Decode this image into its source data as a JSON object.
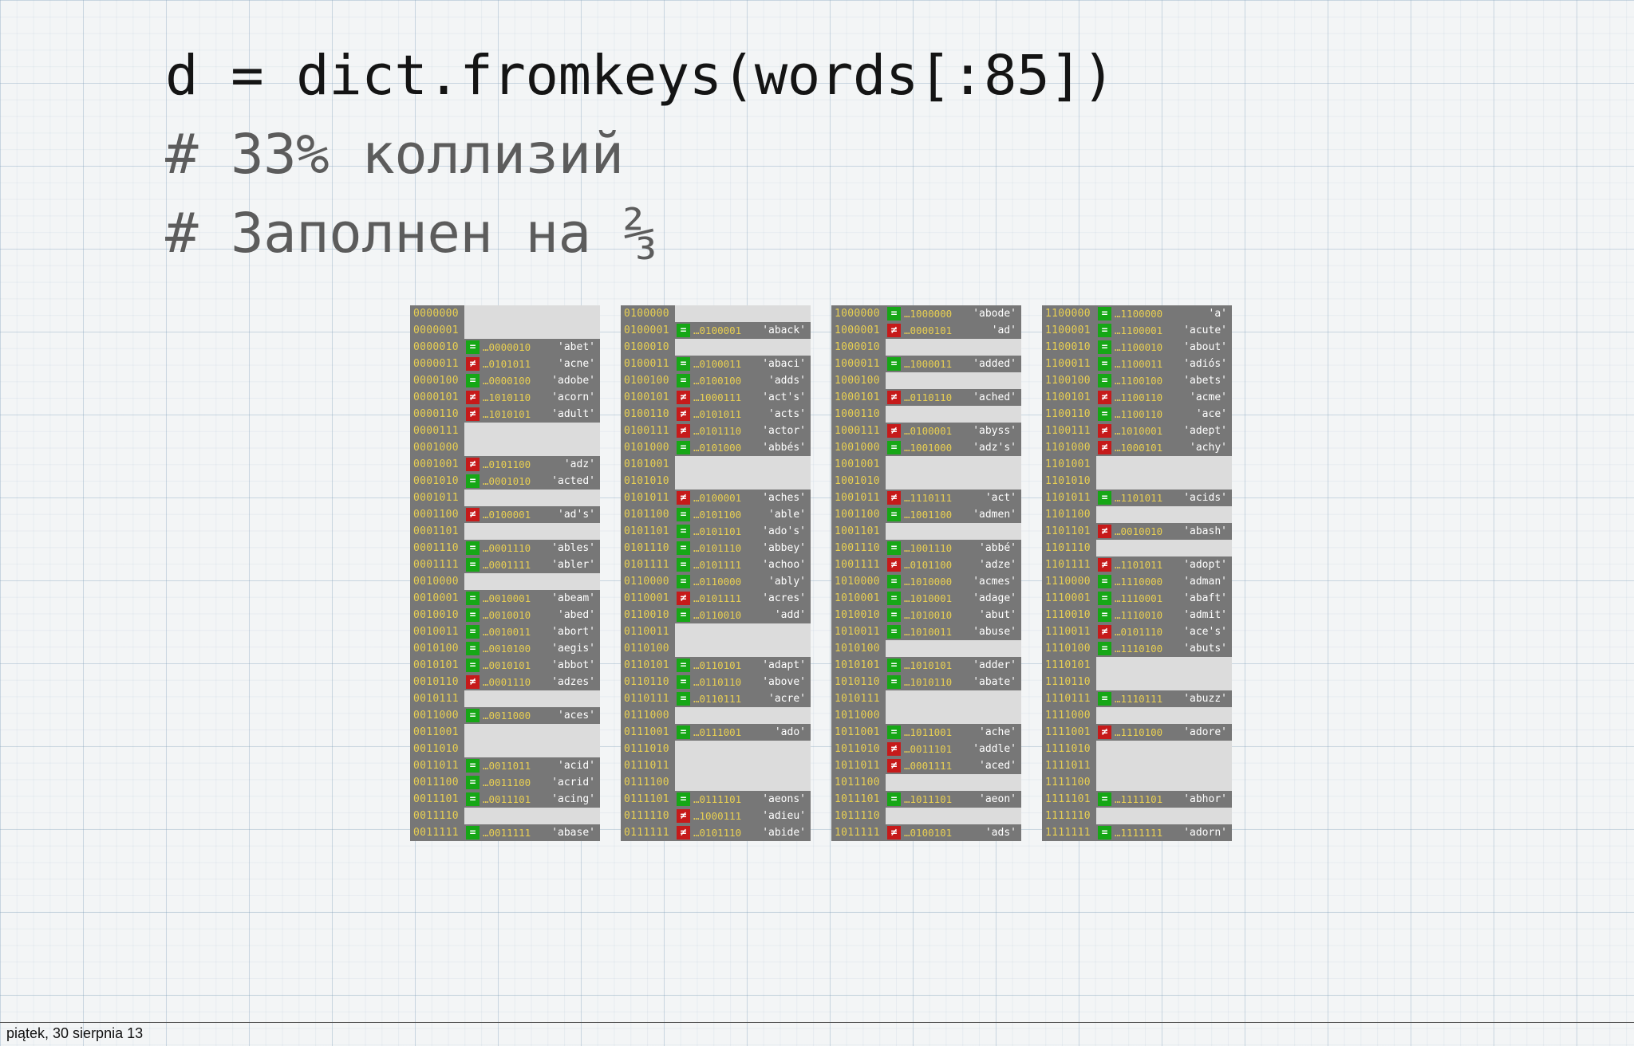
{
  "slide": {
    "code": "d = dict.fromkeys(words[:85])",
    "comment1": "# 33% коллизий",
    "comment2": "# Заполнен на ⅔"
  },
  "table": {
    "columns": [
      {
        "rows": [
          {
            "i": "0000000",
            "m": "",
            "h": "",
            "w": ""
          },
          {
            "i": "0000001",
            "m": "",
            "h": "",
            "w": ""
          },
          {
            "i": "0000010",
            "m": "=",
            "h": "…0000010",
            "w": "'abet'"
          },
          {
            "i": "0000011",
            "m": "≠",
            "h": "…0101011",
            "w": "'acne'"
          },
          {
            "i": "0000100",
            "m": "=",
            "h": "…0000100",
            "w": "'adobe'"
          },
          {
            "i": "0000101",
            "m": "≠",
            "h": "…1010110",
            "w": "'acorn'"
          },
          {
            "i": "0000110",
            "m": "≠",
            "h": "…1010101",
            "w": "'adult'"
          },
          {
            "i": "0000111",
            "m": "",
            "h": "",
            "w": ""
          },
          {
            "i": "0001000",
            "m": "",
            "h": "",
            "w": ""
          },
          {
            "i": "0001001",
            "m": "≠",
            "h": "…0101100",
            "w": "'adz'"
          },
          {
            "i": "0001010",
            "m": "=",
            "h": "…0001010",
            "w": "'acted'"
          },
          {
            "i": "0001011",
            "m": "",
            "h": "",
            "w": ""
          },
          {
            "i": "0001100",
            "m": "≠",
            "h": "…0100001",
            "w": "'ad's'"
          },
          {
            "i": "0001101",
            "m": "",
            "h": "",
            "w": ""
          },
          {
            "i": "0001110",
            "m": "=",
            "h": "…0001110",
            "w": "'ables'"
          },
          {
            "i": "0001111",
            "m": "=",
            "h": "…0001111",
            "w": "'abler'"
          },
          {
            "i": "0010000",
            "m": "",
            "h": "",
            "w": ""
          },
          {
            "i": "0010001",
            "m": "=",
            "h": "…0010001",
            "w": "'abeam'"
          },
          {
            "i": "0010010",
            "m": "=",
            "h": "…0010010",
            "w": "'abed'"
          },
          {
            "i": "0010011",
            "m": "=",
            "h": "…0010011",
            "w": "'abort'"
          },
          {
            "i": "0010100",
            "m": "=",
            "h": "…0010100",
            "w": "'aegis'"
          },
          {
            "i": "0010101",
            "m": "=",
            "h": "…0010101",
            "w": "'abbot'"
          },
          {
            "i": "0010110",
            "m": "≠",
            "h": "…0001110",
            "w": "'adzes'"
          },
          {
            "i": "0010111",
            "m": "",
            "h": "",
            "w": ""
          },
          {
            "i": "0011000",
            "m": "=",
            "h": "…0011000",
            "w": "'aces'"
          },
          {
            "i": "0011001",
            "m": "",
            "h": "",
            "w": ""
          },
          {
            "i": "0011010",
            "m": "",
            "h": "",
            "w": ""
          },
          {
            "i": "0011011",
            "m": "=",
            "h": "…0011011",
            "w": "'acid'"
          },
          {
            "i": "0011100",
            "m": "=",
            "h": "…0011100",
            "w": "'acrid'"
          },
          {
            "i": "0011101",
            "m": "=",
            "h": "…0011101",
            "w": "'acing'"
          },
          {
            "i": "0011110",
            "m": "",
            "h": "",
            "w": ""
          },
          {
            "i": "0011111",
            "m": "=",
            "h": "…0011111",
            "w": "'abase'"
          }
        ]
      },
      {
        "rows": [
          {
            "i": "0100000",
            "m": "",
            "h": "",
            "w": ""
          },
          {
            "i": "0100001",
            "m": "=",
            "h": "…0100001",
            "w": "'aback'"
          },
          {
            "i": "0100010",
            "m": "",
            "h": "",
            "w": ""
          },
          {
            "i": "0100011",
            "m": "=",
            "h": "…0100011",
            "w": "'abaci'"
          },
          {
            "i": "0100100",
            "m": "=",
            "h": "…0100100",
            "w": "'adds'"
          },
          {
            "i": "0100101",
            "m": "≠",
            "h": "…1000111",
            "w": "'act's'"
          },
          {
            "i": "0100110",
            "m": "≠",
            "h": "…0101011",
            "w": "'acts'"
          },
          {
            "i": "0100111",
            "m": "≠",
            "h": "…0101110",
            "w": "'actor'"
          },
          {
            "i": "0101000",
            "m": "=",
            "h": "…0101000",
            "w": "'abbés'"
          },
          {
            "i": "0101001",
            "m": "",
            "h": "",
            "w": ""
          },
          {
            "i": "0101010",
            "m": "",
            "h": "",
            "w": ""
          },
          {
            "i": "0101011",
            "m": "≠",
            "h": "…0100001",
            "w": "'aches'"
          },
          {
            "i": "0101100",
            "m": "=",
            "h": "…0101100",
            "w": "'able'"
          },
          {
            "i": "0101101",
            "m": "=",
            "h": "…0101101",
            "w": "'ado's'"
          },
          {
            "i": "0101110",
            "m": "=",
            "h": "…0101110",
            "w": "'abbey'"
          },
          {
            "i": "0101111",
            "m": "=",
            "h": "…0101111",
            "w": "'achoo'"
          },
          {
            "i": "0110000",
            "m": "=",
            "h": "…0110000",
            "w": "'ably'"
          },
          {
            "i": "0110001",
            "m": "≠",
            "h": "…0101111",
            "w": "'acres'"
          },
          {
            "i": "0110010",
            "m": "=",
            "h": "…0110010",
            "w": "'add'"
          },
          {
            "i": "0110011",
            "m": "",
            "h": "",
            "w": ""
          },
          {
            "i": "0110100",
            "m": "",
            "h": "",
            "w": ""
          },
          {
            "i": "0110101",
            "m": "=",
            "h": "…0110101",
            "w": "'adapt'"
          },
          {
            "i": "0110110",
            "m": "=",
            "h": "…0110110",
            "w": "'above'"
          },
          {
            "i": "0110111",
            "m": "=",
            "h": "…0110111",
            "w": "'acre'"
          },
          {
            "i": "0111000",
            "m": "",
            "h": "",
            "w": ""
          },
          {
            "i": "0111001",
            "m": "=",
            "h": "…0111001",
            "w": "'ado'"
          },
          {
            "i": "0111010",
            "m": "",
            "h": "",
            "w": ""
          },
          {
            "i": "0111011",
            "m": "",
            "h": "",
            "w": ""
          },
          {
            "i": "0111100",
            "m": "",
            "h": "",
            "w": ""
          },
          {
            "i": "0111101",
            "m": "=",
            "h": "…0111101",
            "w": "'aeons'"
          },
          {
            "i": "0111110",
            "m": "≠",
            "h": "…1000111",
            "w": "'adieu'"
          },
          {
            "i": "0111111",
            "m": "≠",
            "h": "…0101110",
            "w": "'abide'"
          }
        ]
      },
      {
        "rows": [
          {
            "i": "1000000",
            "m": "=",
            "h": "…1000000",
            "w": "'abode'"
          },
          {
            "i": "1000001",
            "m": "≠",
            "h": "…0000101",
            "w": "'ad'"
          },
          {
            "i": "1000010",
            "m": "",
            "h": "",
            "w": ""
          },
          {
            "i": "1000011",
            "m": "=",
            "h": "…1000011",
            "w": "'added'"
          },
          {
            "i": "1000100",
            "m": "",
            "h": "",
            "w": ""
          },
          {
            "i": "1000101",
            "m": "≠",
            "h": "…0110110",
            "w": "'ached'"
          },
          {
            "i": "1000110",
            "m": "",
            "h": "",
            "w": ""
          },
          {
            "i": "1000111",
            "m": "≠",
            "h": "…0100001",
            "w": "'abyss'"
          },
          {
            "i": "1001000",
            "m": "=",
            "h": "…1001000",
            "w": "'adz's'"
          },
          {
            "i": "1001001",
            "m": "",
            "h": "",
            "w": ""
          },
          {
            "i": "1001010",
            "m": "",
            "h": "",
            "w": ""
          },
          {
            "i": "1001011",
            "m": "≠",
            "h": "…1110111",
            "w": "'act'"
          },
          {
            "i": "1001100",
            "m": "=",
            "h": "…1001100",
            "w": "'admen'"
          },
          {
            "i": "1001101",
            "m": "",
            "h": "",
            "w": ""
          },
          {
            "i": "1001110",
            "m": "=",
            "h": "…1001110",
            "w": "'abbé'"
          },
          {
            "i": "1001111",
            "m": "≠",
            "h": "…0101100",
            "w": "'adze'"
          },
          {
            "i": "1010000",
            "m": "=",
            "h": "…1010000",
            "w": "'acmes'"
          },
          {
            "i": "1010001",
            "m": "=",
            "h": "…1010001",
            "w": "'adage'"
          },
          {
            "i": "1010010",
            "m": "=",
            "h": "…1010010",
            "w": "'abut'"
          },
          {
            "i": "1010011",
            "m": "=",
            "h": "…1010011",
            "w": "'abuse'"
          },
          {
            "i": "1010100",
            "m": "",
            "h": "",
            "w": ""
          },
          {
            "i": "1010101",
            "m": "=",
            "h": "…1010101",
            "w": "'adder'"
          },
          {
            "i": "1010110",
            "m": "=",
            "h": "…1010110",
            "w": "'abate'"
          },
          {
            "i": "1010111",
            "m": "",
            "h": "",
            "w": ""
          },
          {
            "i": "1011000",
            "m": "",
            "h": "",
            "w": ""
          },
          {
            "i": "1011001",
            "m": "=",
            "h": "…1011001",
            "w": "'ache'"
          },
          {
            "i": "1011010",
            "m": "≠",
            "h": "…0011101",
            "w": "'addle'"
          },
          {
            "i": "1011011",
            "m": "≠",
            "h": "…0001111",
            "w": "'aced'"
          },
          {
            "i": "1011100",
            "m": "",
            "h": "",
            "w": ""
          },
          {
            "i": "1011101",
            "m": "=",
            "h": "…1011101",
            "w": "'aeon'"
          },
          {
            "i": "1011110",
            "m": "",
            "h": "",
            "w": ""
          },
          {
            "i": "1011111",
            "m": "≠",
            "h": "…0100101",
            "w": "'ads'"
          }
        ]
      },
      {
        "rows": [
          {
            "i": "1100000",
            "m": "=",
            "h": "…1100000",
            "w": "'a'"
          },
          {
            "i": "1100001",
            "m": "=",
            "h": "…1100001",
            "w": "'acute'"
          },
          {
            "i": "1100010",
            "m": "=",
            "h": "…1100010",
            "w": "'about'"
          },
          {
            "i": "1100011",
            "m": "=",
            "h": "…1100011",
            "w": "'adiós'"
          },
          {
            "i": "1100100",
            "m": "=",
            "h": "…1100100",
            "w": "'abets'"
          },
          {
            "i": "1100101",
            "m": "≠",
            "h": "…1100110",
            "w": "'acme'"
          },
          {
            "i": "1100110",
            "m": "=",
            "h": "…1100110",
            "w": "'ace'"
          },
          {
            "i": "1100111",
            "m": "≠",
            "h": "…1010001",
            "w": "'adept'"
          },
          {
            "i": "1101000",
            "m": "≠",
            "h": "…1000101",
            "w": "'achy'"
          },
          {
            "i": "1101001",
            "m": "",
            "h": "",
            "w": ""
          },
          {
            "i": "1101010",
            "m": "",
            "h": "",
            "w": ""
          },
          {
            "i": "1101011",
            "m": "=",
            "h": "…1101011",
            "w": "'acids'"
          },
          {
            "i": "1101100",
            "m": "",
            "h": "",
            "w": ""
          },
          {
            "i": "1101101",
            "m": "≠",
            "h": "…0010010",
            "w": "'abash'"
          },
          {
            "i": "1101110",
            "m": "",
            "h": "",
            "w": ""
          },
          {
            "i": "1101111",
            "m": "≠",
            "h": "…1101011",
            "w": "'adopt'"
          },
          {
            "i": "1110000",
            "m": "=",
            "h": "…1110000",
            "w": "'adman'"
          },
          {
            "i": "1110001",
            "m": "=",
            "h": "…1110001",
            "w": "'abaft'"
          },
          {
            "i": "1110010",
            "m": "=",
            "h": "…1110010",
            "w": "'admit'"
          },
          {
            "i": "1110011",
            "m": "≠",
            "h": "…0101110",
            "w": "'ace's'"
          },
          {
            "i": "1110100",
            "m": "=",
            "h": "…1110100",
            "w": "'abuts'"
          },
          {
            "i": "1110101",
            "m": "",
            "h": "",
            "w": ""
          },
          {
            "i": "1110110",
            "m": "",
            "h": "",
            "w": ""
          },
          {
            "i": "1110111",
            "m": "=",
            "h": "…1110111",
            "w": "'abuzz'"
          },
          {
            "i": "1111000",
            "m": "",
            "h": "",
            "w": ""
          },
          {
            "i": "1111001",
            "m": "≠",
            "h": "…1110100",
            "w": "'adore'"
          },
          {
            "i": "1111010",
            "m": "",
            "h": "",
            "w": ""
          },
          {
            "i": "1111011",
            "m": "",
            "h": "",
            "w": ""
          },
          {
            "i": "1111100",
            "m": "",
            "h": "",
            "w": ""
          },
          {
            "i": "1111101",
            "m": "=",
            "h": "…1111101",
            "w": "'abhor'"
          },
          {
            "i": "1111110",
            "m": "",
            "h": "",
            "w": ""
          },
          {
            "i": "1111111",
            "m": "=",
            "h": "…1111111",
            "w": "'adorn'"
          }
        ]
      }
    ]
  },
  "colors": {
    "match": "#16a716",
    "collision": "#c61a1a",
    "filled_row": "#777777",
    "empty_row": "#dcdcdc",
    "index_text": "#e8cf52"
  },
  "footer": {
    "date": "piątek, 30 sierpnia 13"
  }
}
